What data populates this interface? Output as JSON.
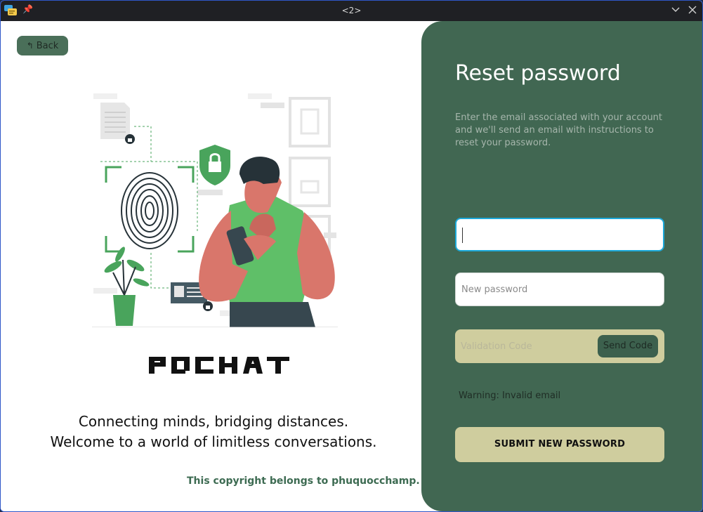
{
  "window": {
    "title": "<2>",
    "controls": {
      "minimize_icon": "chevron-down",
      "close_icon": "close"
    }
  },
  "left": {
    "back_label": "Back",
    "brand": "PQCHAT",
    "tagline_line1": "Connecting minds, bridging distances.",
    "tagline_line2": "Welcome to a world of limitless conversations.",
    "copyright": "This copyright belongs to phuquocchamp."
  },
  "form": {
    "heading": "Reset password",
    "description": "Enter the email associated with your account and we'll send an email with instructions to reset your password.",
    "email_value": "",
    "email_placeholder": "",
    "password_placeholder": "New password",
    "code_placeholder": "Validation Code",
    "send_code_label": "Send Code",
    "warning": "Warning: Invalid email",
    "submit_label": "SUBMIT NEW PASSWORD"
  },
  "colors": {
    "panel_bg": "#416752",
    "accent_khaki": "#cfcd9e",
    "dark_green_button": "#3c604d",
    "focus_border": "#1ca9d9",
    "illustration_green": "#49a45c"
  }
}
